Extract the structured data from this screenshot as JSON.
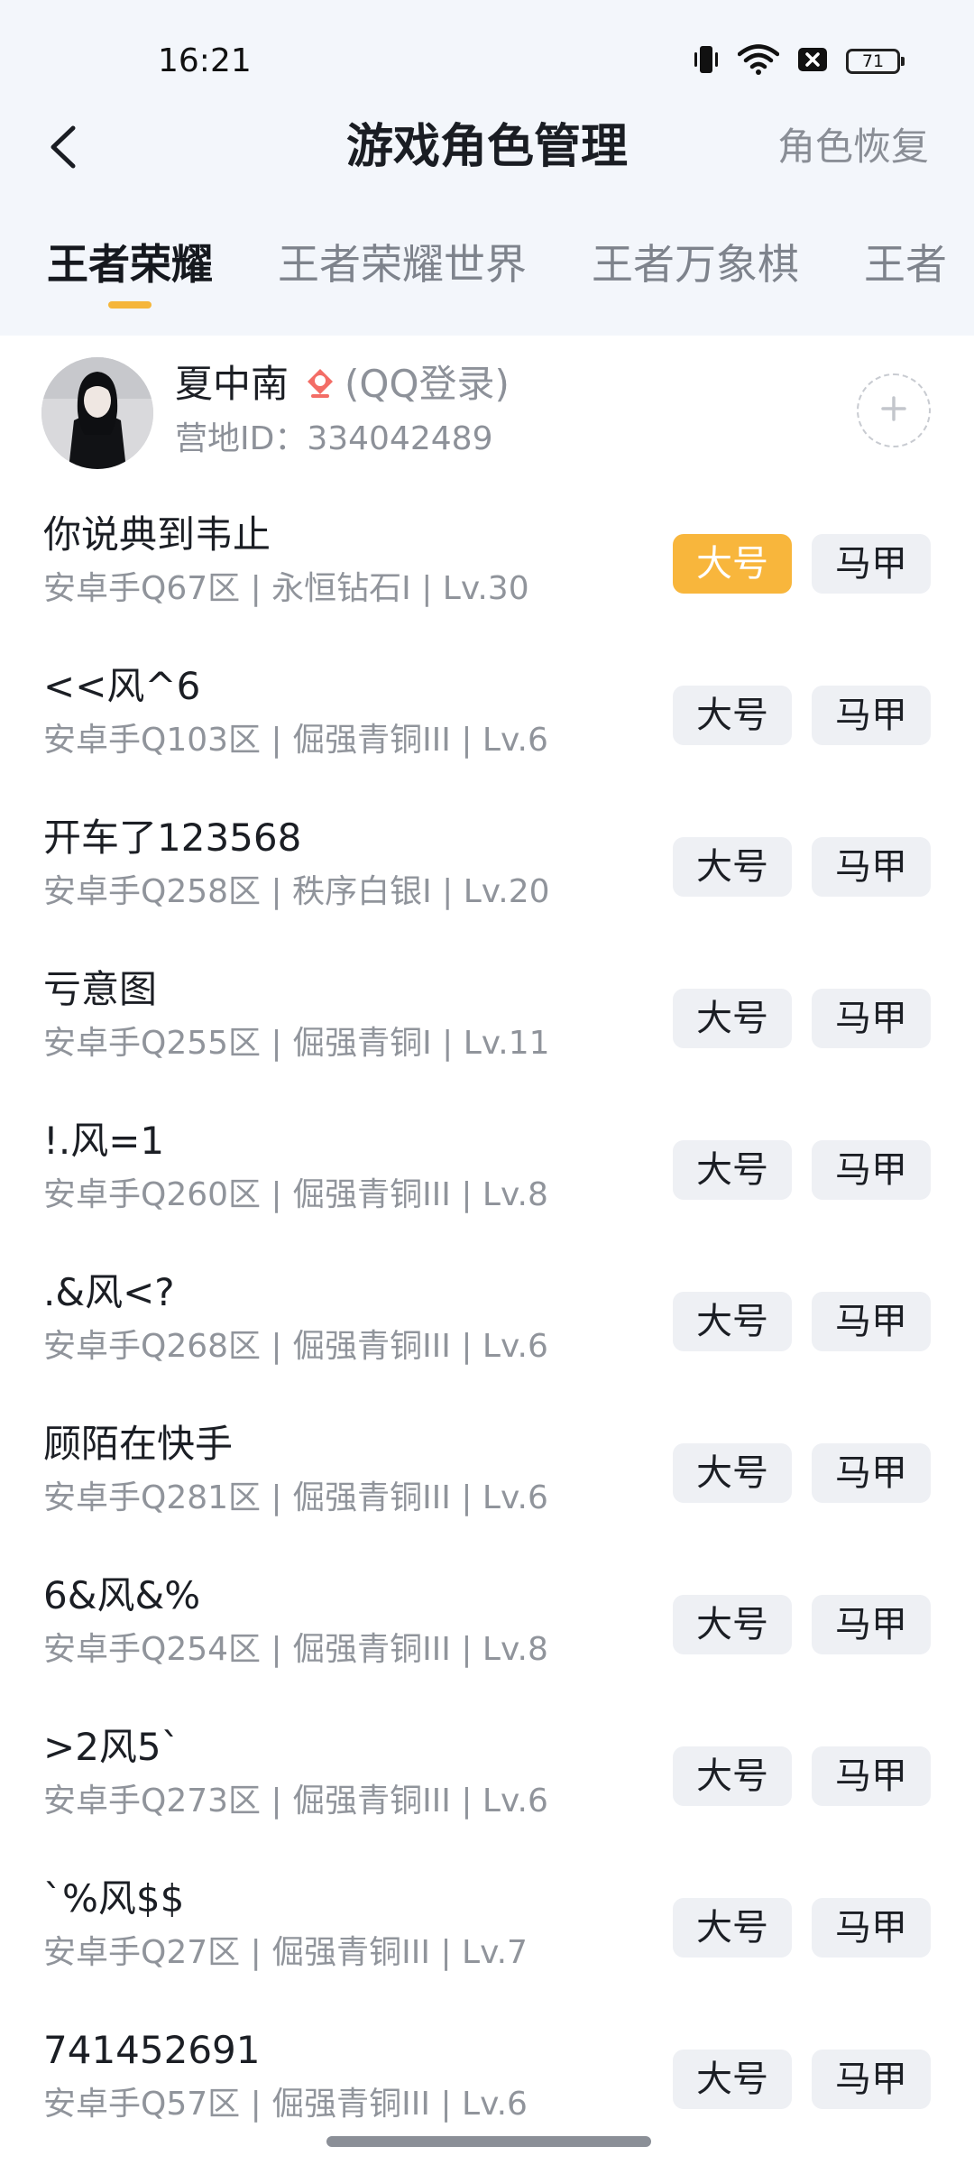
{
  "status_bar": {
    "time": "16:21",
    "battery": "71",
    "icons": [
      "vibrate-icon",
      "wifi-icon",
      "sim-off-icon",
      "battery-icon"
    ]
  },
  "header": {
    "back_icon": "chevron-left-icon",
    "title": "游戏角色管理",
    "action": "角色恢复"
  },
  "tabs": [
    {
      "label": "王者荣耀",
      "active": true
    },
    {
      "label": "王者荣耀世界",
      "active": false
    },
    {
      "label": "王者万象棋",
      "active": false
    },
    {
      "label": "王者",
      "active": false
    }
  ],
  "profile": {
    "name": "夏中南",
    "login_icon": "qq-pin-icon",
    "login_type": "(QQ登录)",
    "camp_id": "营地ID：334042489",
    "add_icon": "plus-icon"
  },
  "roles": [
    {
      "name": "你说典到韦止",
      "info": "安卓手Q67区 | 永恒钻石I | Lv.30",
      "main_label": "大号",
      "alt_label": "马甲",
      "main_selected": true
    },
    {
      "name": "<<风^6",
      "info": "安卓手Q103区 | 倔强青铜III | Lv.6",
      "main_label": "大号",
      "alt_label": "马甲",
      "main_selected": false
    },
    {
      "name": "开车了123568",
      "info": "安卓手Q258区 | 秩序白银I | Lv.20",
      "main_label": "大号",
      "alt_label": "马甲",
      "main_selected": false
    },
    {
      "name": "亏意图",
      "info": "安卓手Q255区 | 倔强青铜I | Lv.11",
      "main_label": "大号",
      "alt_label": "马甲",
      "main_selected": false
    },
    {
      "name": "!.风=1",
      "info": "安卓手Q260区 | 倔强青铜III | Lv.8",
      "main_label": "大号",
      "alt_label": "马甲",
      "main_selected": false
    },
    {
      "name": ".&风<?",
      "info": "安卓手Q268区 | 倔强青铜III | Lv.6",
      "main_label": "大号",
      "alt_label": "马甲",
      "main_selected": false
    },
    {
      "name": "顾陌在快手",
      "info": "安卓手Q281区 | 倔强青铜III | Lv.6",
      "main_label": "大号",
      "alt_label": "马甲",
      "main_selected": false
    },
    {
      "name": "6&风&%",
      "info": "安卓手Q254区 | 倔强青铜III | Lv.8",
      "main_label": "大号",
      "alt_label": "马甲",
      "main_selected": false
    },
    {
      "name": ">2风5`",
      "info": "安卓手Q273区 | 倔强青铜III | Lv.6",
      "main_label": "大号",
      "alt_label": "马甲",
      "main_selected": false
    },
    {
      "name": "`%风$$",
      "info": "安卓手Q27区 | 倔强青铜III | Lv.7",
      "main_label": "大号",
      "alt_label": "马甲",
      "main_selected": false
    },
    {
      "name": "741452691",
      "info": "安卓手Q57区 | 倔强青铜III | Lv.6",
      "main_label": "大号",
      "alt_label": "马甲",
      "main_selected": false
    }
  ],
  "colors": {
    "accent": "#f8b63c",
    "header_bg": "#f3f6fb",
    "button_bg": "#eef0f4",
    "secondary_text": "#90949b"
  }
}
